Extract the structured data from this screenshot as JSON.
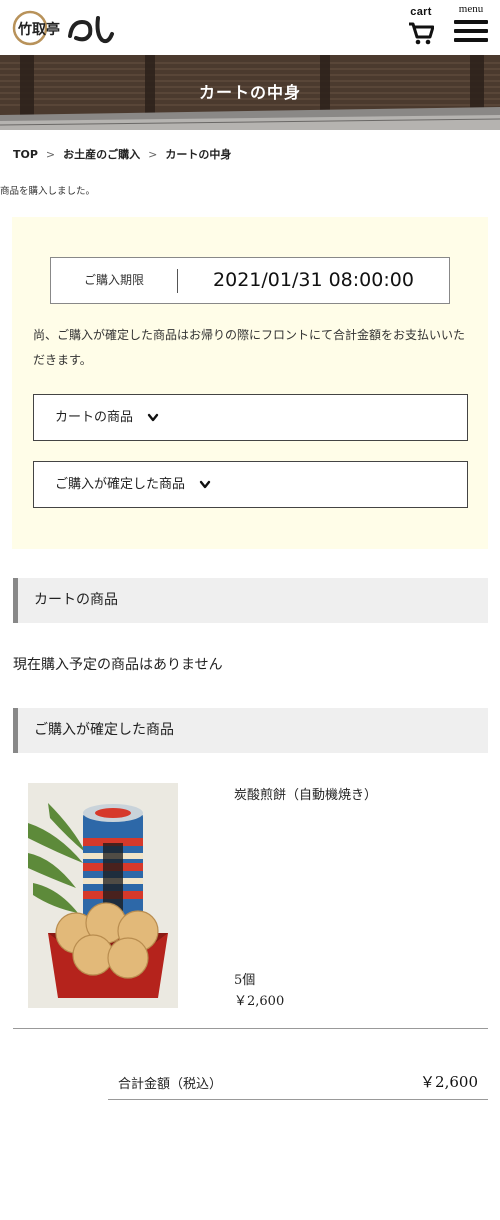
{
  "header": {
    "logo_alt": "竹取亭 円山",
    "cart_label": "cart",
    "menu_label": "menu"
  },
  "hero": {
    "title": "カートの中身"
  },
  "breadcrumb": {
    "items": [
      "TOP",
      "お土産のご購入",
      "カートの中身"
    ],
    "separator": ">"
  },
  "notice": "商品を購入しました。",
  "panel": {
    "deadline_label": "ご購入期限",
    "deadline_value": "2021/01/31 08:00:00",
    "note": "尚、ご購入が確定した商品はお帰りの際にフロントにて合計金額をお支払いいただきます。",
    "toggle_cart": "カートの商品",
    "toggle_confirmed": "ご購入が確定した商品"
  },
  "cart_section": {
    "title": "カートの商品",
    "empty_text": "現在購入予定の商品はありません"
  },
  "confirmed_section": {
    "title": "ご購入が確定した商品",
    "items": [
      {
        "name": "炭酸煎餅（自動機焼き）",
        "qty": "5個",
        "price": "￥2,600",
        "image": "product-photo"
      }
    ]
  },
  "total": {
    "label": "合計金額（税込）",
    "value": "￥2,600"
  },
  "colors": {
    "panel_bg": "#fffde8",
    "section_bg": "#efefef",
    "section_accent": "#888888"
  }
}
